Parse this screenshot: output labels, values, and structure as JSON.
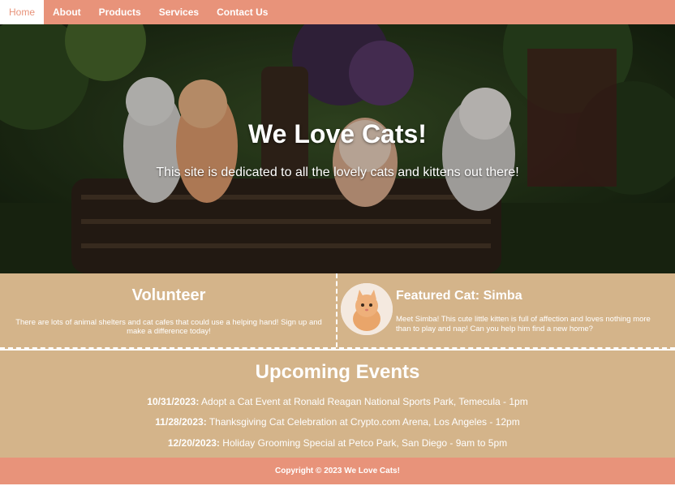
{
  "nav": {
    "items": [
      {
        "label": "Home",
        "active": true
      },
      {
        "label": "About"
      },
      {
        "label": "Products"
      },
      {
        "label": "Services"
      },
      {
        "label": "Contact Us"
      }
    ]
  },
  "hero": {
    "title": "We Love Cats!",
    "subtitle": "This site is dedicated to all the lovely cats and kittens out there!"
  },
  "volunteer": {
    "title": "Volunteer",
    "text": "There are lots of animal shelters and cat cafes that could use a helping hand! Sign up and make a difference today!"
  },
  "featured": {
    "title": "Featured Cat: Simba",
    "text": "Meet Simba! This cute little kitten is full of affection and loves nothing more than to play and nap! Can you help him find a new home?"
  },
  "events": {
    "title": "Upcoming Events",
    "items": [
      {
        "date": "10/31/2023:",
        "text": " Adopt a Cat Event at Ronald Reagan National Sports Park, Temecula - 1pm"
      },
      {
        "date": "11/28/2023:",
        "text": " Thanksgiving Cat Celebration at Crypto.com Arena, Los Angeles - 12pm"
      },
      {
        "date": "12/20/2023:",
        "text": " Holiday Grooming Special at Petco Park, San Diego - 9am to 5pm"
      }
    ]
  },
  "footer": {
    "text": "Copyright © 2023 We Love Cats!"
  },
  "colors": {
    "nav_bg": "#e8937a",
    "section_bg": "#d4b48a",
    "text": "#ffffff"
  }
}
